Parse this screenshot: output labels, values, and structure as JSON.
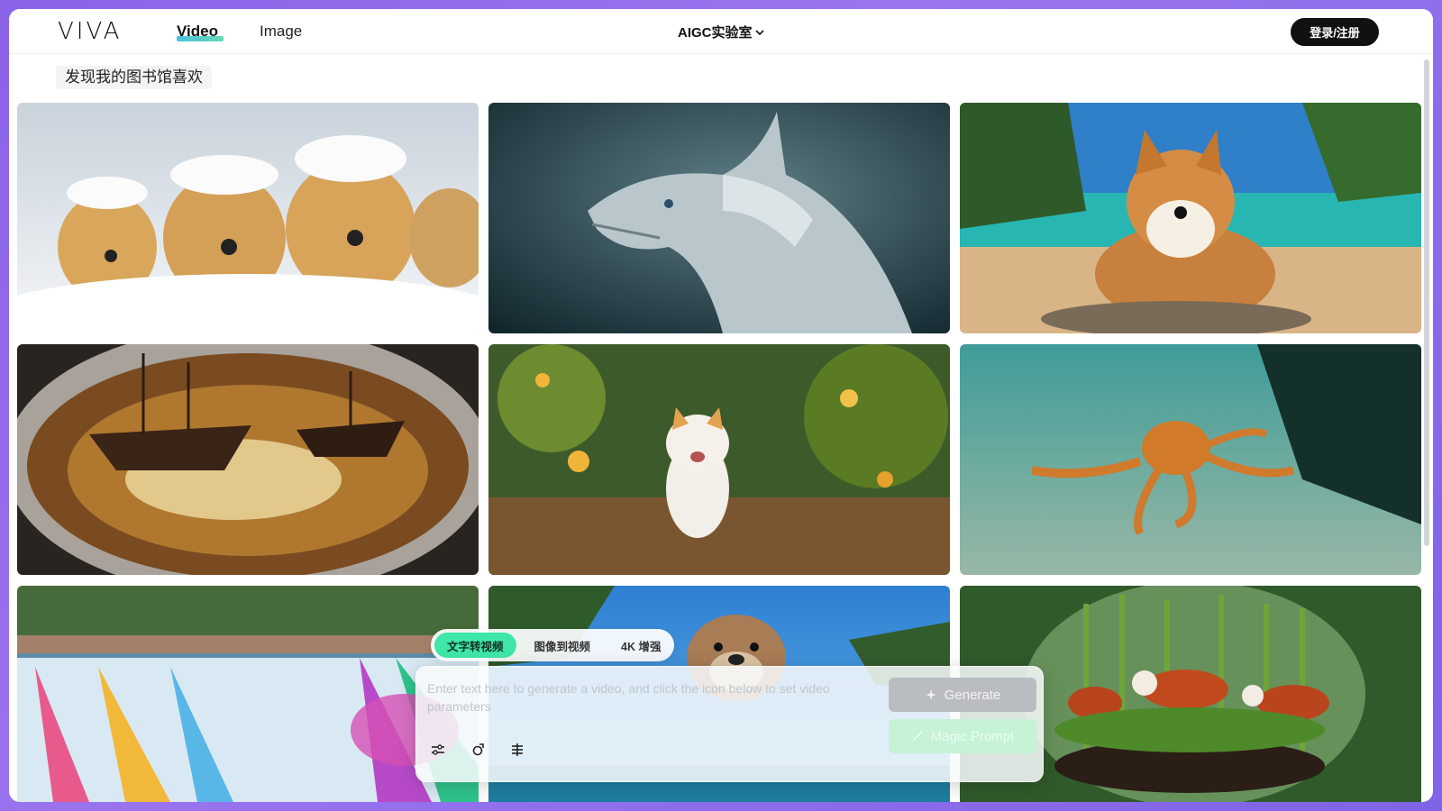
{
  "header": {
    "logo": "VIVA",
    "nav": [
      {
        "label": "Video",
        "active": true
      },
      {
        "label": "Image",
        "active": false
      }
    ],
    "lab_menu": "AIGC实验室",
    "login_label": "登录/注册"
  },
  "section_title": "发现我的图书馆喜欢",
  "gallery": [
    {
      "subject": "golden retriever puppies in snow"
    },
    {
      "subject": "white dragon"
    },
    {
      "subject": "corgi on tropical beach"
    },
    {
      "subject": "pirate ships in a cup of coffee"
    },
    {
      "subject": "white cat walking on forest path"
    },
    {
      "subject": "orange octopus on sea floor"
    },
    {
      "subject": "rainbow waterfalls"
    },
    {
      "subject": "otter under sunny sky"
    },
    {
      "subject": "red pandas in glass bowl"
    }
  ],
  "composer": {
    "tabs": [
      {
        "label": "文字转视频",
        "active": true
      },
      {
        "label": "图像到视频",
        "active": false
      },
      {
        "label": "4K 增强",
        "active": false
      }
    ],
    "prompt_placeholder": "Enter text here to generate a video, and click the icon below to set video parameters",
    "generate_label": "Generate",
    "magic_prompt_label": "Magic Prompt",
    "tool_icons": [
      "sliders-icon",
      "camera-motion-icon",
      "style-icon"
    ]
  },
  "colors": {
    "accent_green": "#3ee6a7",
    "frame_purple": "#8a63e8",
    "login_button": "#111111"
  }
}
